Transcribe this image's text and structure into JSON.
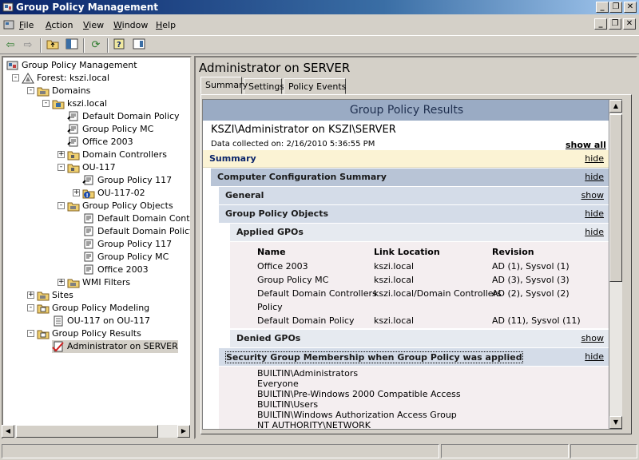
{
  "window": {
    "title": "Group Policy Management"
  },
  "menu": [
    {
      "underline": "F",
      "rest": "ile"
    },
    {
      "underline": "A",
      "rest": "ction"
    },
    {
      "underline": "V",
      "rest": "iew"
    },
    {
      "underline": "W",
      "rest": "indow"
    },
    {
      "underline": "H",
      "rest": "elp"
    }
  ],
  "tree": [
    {
      "label": "Group Policy Management",
      "icon": "gpm-icon",
      "level": 0,
      "expander": ""
    },
    {
      "label": "Forest: kszi.local",
      "icon": "forest-icon",
      "level": 1,
      "expander": "-"
    },
    {
      "label": "Domains",
      "icon": "folder-icon",
      "level": 2,
      "expander": "-"
    },
    {
      "label": "kszi.local",
      "icon": "domain-icon",
      "level": 3,
      "expander": "-"
    },
    {
      "label": "Default Domain Policy",
      "icon": "gpo-link-icon",
      "level": 4,
      "expander": ""
    },
    {
      "label": "Group Policy MC",
      "icon": "gpo-link-icon",
      "level": 4,
      "expander": ""
    },
    {
      "label": "Office 2003",
      "icon": "gpo-link-icon",
      "level": 4,
      "expander": ""
    },
    {
      "label": "Domain Controllers",
      "icon": "ou-icon",
      "level": 4,
      "expander": "+"
    },
    {
      "label": "OU-117",
      "icon": "ou-icon",
      "level": 4,
      "expander": "-"
    },
    {
      "label": "Group Policy 117",
      "icon": "gpo-link-icon",
      "level": 5,
      "expander": ""
    },
    {
      "label": "OU-117-02",
      "icon": "ou-blocked-icon",
      "level": 5,
      "expander": "+"
    },
    {
      "label": "Group Policy Objects",
      "icon": "folder-icon",
      "level": 4,
      "expander": "-"
    },
    {
      "label": "Default Domain Controlle",
      "icon": "gpo-icon",
      "level": 5,
      "expander": ""
    },
    {
      "label": "Default Domain Policy",
      "icon": "gpo-icon",
      "level": 5,
      "expander": ""
    },
    {
      "label": "Group Policy 117",
      "icon": "gpo-icon",
      "level": 5,
      "expander": ""
    },
    {
      "label": "Group Policy MC",
      "icon": "gpo-icon",
      "level": 5,
      "expander": ""
    },
    {
      "label": "Office 2003",
      "icon": "gpo-icon",
      "level": 5,
      "expander": ""
    },
    {
      "label": "WMI Filters",
      "icon": "folder-icon",
      "level": 4,
      "expander": "+"
    },
    {
      "label": "Sites",
      "icon": "folder-icon",
      "level": 2,
      "expander": "+"
    },
    {
      "label": "Group Policy Modeling",
      "icon": "modeling-icon",
      "level": 2,
      "expander": "-"
    },
    {
      "label": "OU-117 on OU-117",
      "icon": "report-icon",
      "level": 3,
      "expander": ""
    },
    {
      "label": "Group Policy Results",
      "icon": "results-icon",
      "level": 2,
      "expander": "-"
    },
    {
      "label": "Administrator on SERVER",
      "icon": "result-check-icon",
      "level": 3,
      "expander": "",
      "selected": true
    }
  ],
  "right": {
    "title": "Administrator on SERVER",
    "tabs": [
      "Summary",
      "Settings",
      "Policy Events"
    ],
    "report": {
      "header": "Group Policy Results",
      "user_line": "KSZI\\Administrator on KSZI\\SERVER",
      "collected": "Data collected on: 2/16/2010 5:36:55 PM",
      "show_all": "show all",
      "summary": {
        "label": "Summary",
        "action": "hide"
      },
      "computer_config": {
        "label": "Computer Configuration Summary",
        "action": "hide"
      },
      "general": {
        "label": "General",
        "action": "show"
      },
      "gpo": {
        "label": "Group Policy Objects",
        "action": "hide"
      },
      "applied": {
        "label": "Applied GPOs",
        "action": "hide"
      },
      "columns": [
        "Name",
        "Link Location",
        "Revision"
      ],
      "rows": [
        [
          "Office 2003",
          "kszi.local",
          "AD (1), Sysvol (1)"
        ],
        [
          "Group Policy MC",
          "kszi.local",
          "AD (3), Sysvol (3)"
        ],
        [
          "Default Domain Controllers",
          "kszi.local/Domain Controllers",
          "AD (2), Sysvol (2)"
        ],
        [
          "Policy",
          "",
          ""
        ],
        [
          "Default Domain Policy",
          "kszi.local",
          "AD (11), Sysvol (11)"
        ]
      ],
      "denied": {
        "label": "Denied GPOs",
        "action": "show"
      },
      "security": {
        "label": "Security Group Membership when Group Policy was applied",
        "action": "hide"
      },
      "groups": [
        "BUILTIN\\Administrators",
        "Everyone",
        "BUILTIN\\Pre-Windows 2000 Compatible Access",
        "BUILTIN\\Users",
        "BUILTIN\\Windows Authorization Access Group",
        "NT AUTHORITY\\NETWORK"
      ]
    }
  },
  "colors": {
    "report_header": "#9aabc4",
    "summary_band": "#fbf3d4",
    "section": "#b8c4d6",
    "subsection": "#d4dce8",
    "body": "#f4eef0"
  }
}
